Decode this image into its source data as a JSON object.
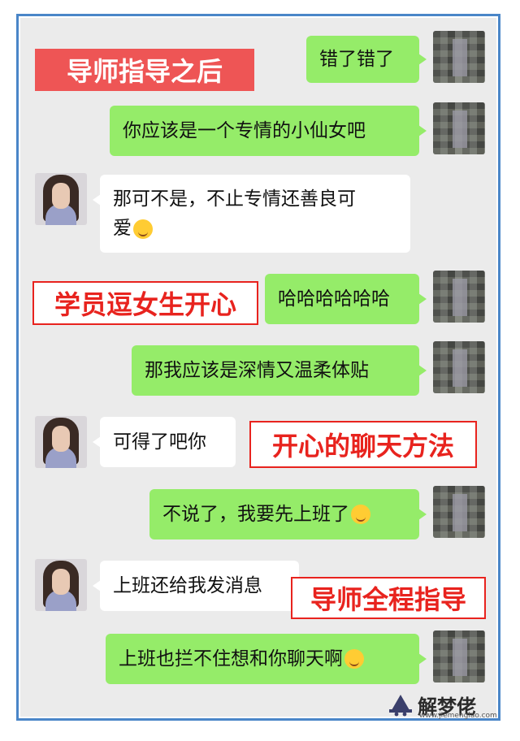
{
  "tags": {
    "mentor_after": "导师指导之后",
    "student_amuse": "学员逗女生开心",
    "happy_method": "开心的聊天方法",
    "mentor_full": "导师全程指导"
  },
  "messages": [
    {
      "side": "me",
      "text": "错了错了"
    },
    {
      "side": "me",
      "text": "你应该是一个专情的小仙女吧"
    },
    {
      "side": "her",
      "text": "那可不是，不止专情还善良可",
      "text2": "爱",
      "emoji": "heart-eyes-emoji"
    },
    {
      "side": "me",
      "text": "哈哈哈哈哈哈"
    },
    {
      "side": "me",
      "text": "那我应该是深情又温柔体贴"
    },
    {
      "side": "her",
      "text": "可得了吧你"
    },
    {
      "side": "me",
      "text": "不说了，我要先上班了",
      "emoji": "crying-laughing-emoji"
    },
    {
      "side": "her",
      "text": "上班还给我发消息"
    },
    {
      "side": "me",
      "text": "上班也拦不住想和你聊天啊",
      "emoji": "thinking-emoji"
    }
  ],
  "watermark": {
    "name": "解梦佬",
    "url": "www.jiemenglao.com"
  },
  "colors": {
    "green_bubble": "#95ec69",
    "frame_border": "#4a86c8",
    "tag_red": "#e8231e",
    "chat_bg": "#ebebeb"
  }
}
